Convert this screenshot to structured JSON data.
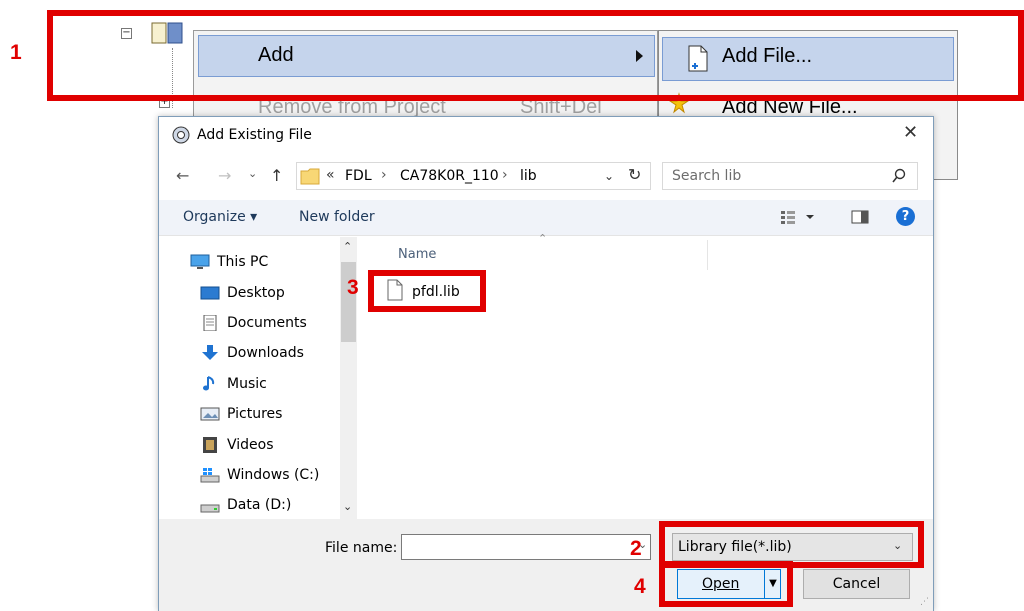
{
  "steps": [
    "1",
    "2",
    "3",
    "4"
  ],
  "context_menu": {
    "add_label": "Add",
    "remove_label": "Remove from Project",
    "remove_shortcut": "Shift+Del"
  },
  "submenu": {
    "add_file_label": "Add File...",
    "add_new_file_label": "Add New File..."
  },
  "dialog": {
    "title": "Add Existing File",
    "close_glyph": "✕",
    "address": {
      "chevrons": "«",
      "path": [
        "FDL",
        "CA78K0R_110",
        "lib"
      ],
      "separator": "›"
    },
    "search": {
      "placeholder": "Search lib"
    },
    "toolbar": {
      "organize": "Organize ▾",
      "new_folder": "New folder"
    },
    "nav_items": [
      {
        "label": "This PC",
        "icon": "pc-icon"
      },
      {
        "label": "Desktop",
        "icon": "desktop-icon"
      },
      {
        "label": "Documents",
        "icon": "documents-icon"
      },
      {
        "label": "Downloads",
        "icon": "downloads-icon"
      },
      {
        "label": "Music",
        "icon": "music-icon"
      },
      {
        "label": "Pictures",
        "icon": "pictures-icon"
      },
      {
        "label": "Videos",
        "icon": "videos-icon"
      },
      {
        "label": "Windows (C:)",
        "icon": "drive-windows-icon"
      },
      {
        "label": "Data (D:)",
        "icon": "drive-data-icon"
      }
    ],
    "column_header": "Name",
    "files": [
      {
        "name": "pfdl.lib",
        "icon": "file-icon"
      }
    ],
    "file_name_label": "File name:",
    "file_name_value": "",
    "filter_value": "Library file(*.lib)",
    "open_button": "Open",
    "cancel_button": "Cancel"
  },
  "colors": {
    "highlight": "#e00000",
    "menu_selected": "#c5d4ec",
    "help_icon": "#1a6fd4"
  }
}
